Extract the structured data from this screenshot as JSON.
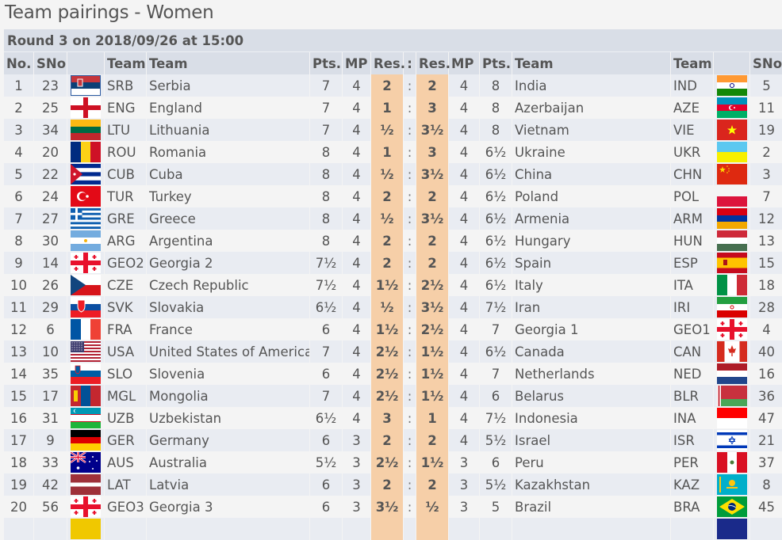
{
  "page": {
    "title": "Team pairings - Women"
  },
  "round": {
    "label": "Round 3 on 2018/09/26 at 15:00"
  },
  "columns": {
    "no": "No.",
    "sno": "SNo",
    "flag": "",
    "team_code": "Team",
    "team_name": "Team",
    "pts": "Pts.",
    "mp": "MP",
    "res": "Res.",
    "sep": ":",
    "res2": "Res.",
    "mp2": "MP",
    "pts2": "Pts.",
    "team_name2": "Team",
    "team_code2": "Team",
    "flag2": "",
    "sno2": "SNo"
  },
  "accent": {
    "result_bg": "#f6cfa8",
    "header_bg": "#d9dee7",
    "row_alt_bg": "#e9ecf2"
  },
  "rows": [
    {
      "no": "1",
      "sno": "23",
      "code": "SRB",
      "name": "Serbia",
      "pts": "7",
      "mp": "4",
      "res": "2",
      "res2": "2",
      "mp2": "4",
      "pts2": "8",
      "name2": "India",
      "code2": "IND",
      "sno2": "5",
      "flag": "serbia",
      "flag2": "india"
    },
    {
      "no": "2",
      "sno": "25",
      "code": "ENG",
      "name": "England",
      "pts": "7",
      "mp": "4",
      "res": "1",
      "res2": "3",
      "mp2": "4",
      "pts2": "8",
      "name2": "Azerbaijan",
      "code2": "AZE",
      "sno2": "11",
      "flag": "england",
      "flag2": "azerbaijan"
    },
    {
      "no": "3",
      "sno": "34",
      "code": "LTU",
      "name": "Lithuania",
      "pts": "7",
      "mp": "4",
      "res": "½",
      "res2": "3½",
      "mp2": "4",
      "pts2": "8",
      "name2": "Vietnam",
      "code2": "VIE",
      "sno2": "19",
      "flag": "lithuania",
      "flag2": "vietnam"
    },
    {
      "no": "4",
      "sno": "20",
      "code": "ROU",
      "name": "Romania",
      "pts": "8",
      "mp": "4",
      "res": "1",
      "res2": "3",
      "mp2": "4",
      "pts2": "6½",
      "name2": "Ukraine",
      "code2": "UKR",
      "sno2": "2",
      "flag": "romania",
      "flag2": "ukraine"
    },
    {
      "no": "5",
      "sno": "22",
      "code": "CUB",
      "name": "Cuba",
      "pts": "8",
      "mp": "4",
      "res": "½",
      "res2": "3½",
      "mp2": "4",
      "pts2": "6½",
      "name2": "China",
      "code2": "CHN",
      "sno2": "3",
      "flag": "cuba",
      "flag2": "china"
    },
    {
      "no": "6",
      "sno": "24",
      "code": "TUR",
      "name": "Turkey",
      "pts": "8",
      "mp": "4",
      "res": "2",
      "res2": "2",
      "mp2": "4",
      "pts2": "6½",
      "name2": "Poland",
      "code2": "POL",
      "sno2": "7",
      "flag": "turkey",
      "flag2": "poland"
    },
    {
      "no": "7",
      "sno": "27",
      "code": "GRE",
      "name": "Greece",
      "pts": "8",
      "mp": "4",
      "res": "½",
      "res2": "3½",
      "mp2": "4",
      "pts2": "6½",
      "name2": "Armenia",
      "code2": "ARM",
      "sno2": "12",
      "flag": "greece",
      "flag2": "armenia"
    },
    {
      "no": "8",
      "sno": "30",
      "code": "ARG",
      "name": "Argentina",
      "pts": "8",
      "mp": "4",
      "res": "2",
      "res2": "2",
      "mp2": "4",
      "pts2": "6½",
      "name2": "Hungary",
      "code2": "HUN",
      "sno2": "13",
      "flag": "argentina",
      "flag2": "hungary"
    },
    {
      "no": "9",
      "sno": "14",
      "code": "GEO2",
      "name": "Georgia 2",
      "pts": "7½",
      "mp": "4",
      "res": "2",
      "res2": "2",
      "mp2": "4",
      "pts2": "6½",
      "name2": "Spain",
      "code2": "ESP",
      "sno2": "15",
      "flag": "georgia",
      "flag2": "spain"
    },
    {
      "no": "10",
      "sno": "26",
      "code": "CZE",
      "name": "Czech Republic",
      "pts": "7½",
      "mp": "4",
      "res": "1½",
      "res2": "2½",
      "mp2": "4",
      "pts2": "6½",
      "name2": "Italy",
      "code2": "ITA",
      "sno2": "18",
      "flag": "czech",
      "flag2": "italy"
    },
    {
      "no": "11",
      "sno": "29",
      "code": "SVK",
      "name": "Slovakia",
      "pts": "6½",
      "mp": "4",
      "res": "½",
      "res2": "3½",
      "mp2": "4",
      "pts2": "7½",
      "name2": "Iran",
      "code2": "IRI",
      "sno2": "28",
      "flag": "slovakia",
      "flag2": "iran"
    },
    {
      "no": "12",
      "sno": "6",
      "code": "FRA",
      "name": "France",
      "pts": "6",
      "mp": "4",
      "res": "1½",
      "res2": "2½",
      "mp2": "4",
      "pts2": "7",
      "name2": "Georgia 1",
      "code2": "GEO1",
      "sno2": "4",
      "flag": "france",
      "flag2": "georgia"
    },
    {
      "no": "13",
      "sno": "10",
      "code": "USA",
      "name": "United States of America",
      "pts": "7",
      "mp": "4",
      "res": "2½",
      "res2": "1½",
      "mp2": "4",
      "pts2": "6½",
      "name2": "Canada",
      "code2": "CAN",
      "sno2": "40",
      "flag": "usa",
      "flag2": "canada"
    },
    {
      "no": "14",
      "sno": "35",
      "code": "SLO",
      "name": "Slovenia",
      "pts": "6",
      "mp": "4",
      "res": "2½",
      "res2": "1½",
      "mp2": "4",
      "pts2": "7",
      "name2": "Netherlands",
      "code2": "NED",
      "sno2": "16",
      "flag": "slovenia",
      "flag2": "netherlands"
    },
    {
      "no": "15",
      "sno": "17",
      "code": "MGL",
      "name": "Mongolia",
      "pts": "7",
      "mp": "4",
      "res": "2½",
      "res2": "1½",
      "mp2": "4",
      "pts2": "6",
      "name2": "Belarus",
      "code2": "BLR",
      "sno2": "36",
      "flag": "mongolia",
      "flag2": "belarus"
    },
    {
      "no": "16",
      "sno": "31",
      "code": "UZB",
      "name": "Uzbekistan",
      "pts": "6½",
      "mp": "4",
      "res": "3",
      "res2": "1",
      "mp2": "4",
      "pts2": "7½",
      "name2": "Indonesia",
      "code2": "INA",
      "sno2": "47",
      "flag": "uzbekistan",
      "flag2": "indonesia"
    },
    {
      "no": "17",
      "sno": "9",
      "code": "GER",
      "name": "Germany",
      "pts": "6",
      "mp": "3",
      "res": "2",
      "res2": "2",
      "mp2": "4",
      "pts2": "5½",
      "name2": "Israel",
      "code2": "ISR",
      "sno2": "21",
      "flag": "germany",
      "flag2": "israel"
    },
    {
      "no": "18",
      "sno": "33",
      "code": "AUS",
      "name": "Australia",
      "pts": "5½",
      "mp": "3",
      "res": "2½",
      "res2": "1½",
      "mp2": "3",
      "pts2": "6",
      "name2": "Peru",
      "code2": "PER",
      "sno2": "37",
      "flag": "australia",
      "flag2": "peru"
    },
    {
      "no": "19",
      "sno": "42",
      "code": "LAT",
      "name": "Latvia",
      "pts": "6",
      "mp": "3",
      "res": "2",
      "res2": "2",
      "mp2": "3",
      "pts2": "5½",
      "name2": "Kazakhstan",
      "code2": "KAZ",
      "sno2": "8",
      "flag": "latvia",
      "flag2": "kazakhstan"
    },
    {
      "no": "20",
      "sno": "56",
      "code": "GEO3",
      "name": "Georgia 3",
      "pts": "6",
      "mp": "3",
      "res": "3½",
      "res2": "½",
      "mp2": "3",
      "pts2": "5",
      "name2": "Brazil",
      "code2": "BRA",
      "sno2": "45",
      "flag": "georgia",
      "flag2": "brazil"
    }
  ]
}
